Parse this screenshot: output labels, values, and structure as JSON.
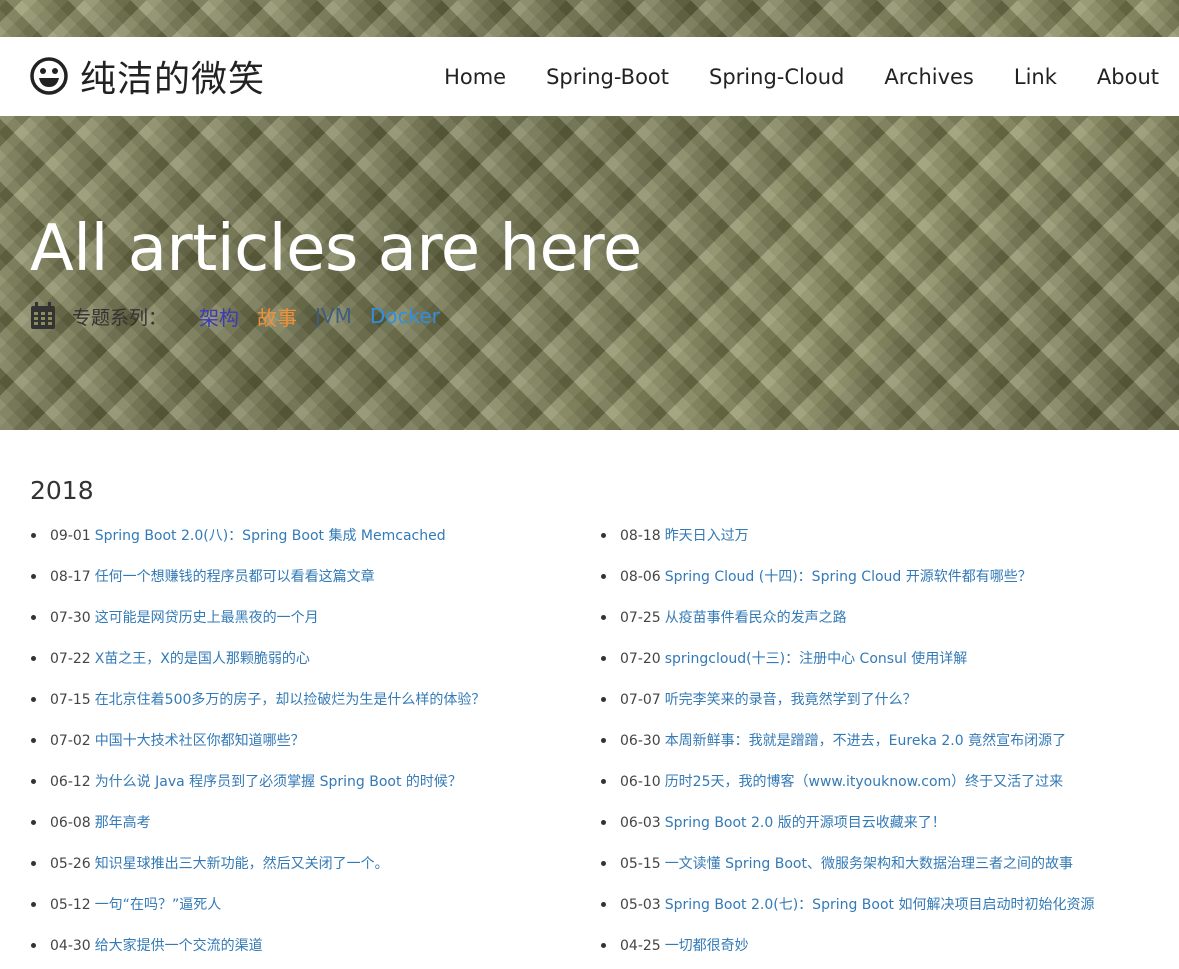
{
  "brand": {
    "icon": "smiley-icon",
    "title": "纯洁的微笑"
  },
  "nav": [
    {
      "label": "Home"
    },
    {
      "label": "Spring-Boot"
    },
    {
      "label": "Spring-Cloud"
    },
    {
      "label": "Archives"
    },
    {
      "label": "Link"
    },
    {
      "label": "About"
    }
  ],
  "hero": {
    "title": "All articles are here",
    "topics_icon": "calendar-icon",
    "topics_label": "专题系列：",
    "topics": [
      {
        "label": "架构",
        "color": "#3d3ab5"
      },
      {
        "label": "故事",
        "color": "#f0913a"
      },
      {
        "label": "JVM",
        "color": "#3f5e7e"
      },
      {
        "label": "Docker",
        "color": "#2f8fe0"
      }
    ]
  },
  "colors": {
    "link": "#337ab7",
    "header_bg": "#7f8253"
  },
  "archive": {
    "year": "2018",
    "left": [
      {
        "date": "09-01",
        "title": "Spring Boot 2.0(八)：Spring Boot 集成 Memcached"
      },
      {
        "date": "08-17",
        "title": "任何一个想赚钱的程序员都可以看看这篇文章"
      },
      {
        "date": "07-30",
        "title": "这可能是网贷历史上最黑夜的一个月"
      },
      {
        "date": "07-22",
        "title": "X苗之王，X的是国人那颗脆弱的心"
      },
      {
        "date": "07-15",
        "title": "在北京住着500多万的房子，却以捡破烂为生是什么样的体验？"
      },
      {
        "date": "07-02",
        "title": "中国十大技术社区你都知道哪些？"
      },
      {
        "date": "06-12",
        "title": "为什么说 Java 程序员到了必须掌握 Spring Boot 的时候？"
      },
      {
        "date": "06-08",
        "title": "那年高考"
      },
      {
        "date": "05-26",
        "title": "知识星球推出三大新功能，然后又关闭了一个。"
      },
      {
        "date": "05-12",
        "title": "一句“在吗？”逼死人"
      },
      {
        "date": "04-30",
        "title": "给大家提供一个交流的渠道"
      }
    ],
    "right": [
      {
        "date": "08-18",
        "title": "昨天日入过万"
      },
      {
        "date": "08-06",
        "title": "Spring Cloud (十四)：Spring Cloud 开源软件都有哪些？"
      },
      {
        "date": "07-25",
        "title": "从疫苗事件看民众的发声之路"
      },
      {
        "date": "07-20",
        "title": "springcloud(十三)：注册中心 Consul 使用详解"
      },
      {
        "date": "07-07",
        "title": "听完李笑来的录音，我竟然学到了什么？"
      },
      {
        "date": "06-30",
        "title": "本周新鲜事：我就是蹭蹭，不进去，Eureka 2.0 竟然宣布闭源了"
      },
      {
        "date": "06-10",
        "title": "历时25天，我的博客（www.ityouknow.com）终于又活了过来"
      },
      {
        "date": "06-03",
        "title": "Spring Boot 2.0 版的开源项目云收藏来了！"
      },
      {
        "date": "05-15",
        "title": "一文读懂 Spring Boot、微服务架构和大数据治理三者之间的故事"
      },
      {
        "date": "05-03",
        "title": "Spring Boot 2.0(七)：Spring Boot 如何解决项目启动时初始化资源"
      },
      {
        "date": "04-25",
        "title": "一切都很奇妙"
      }
    ]
  }
}
